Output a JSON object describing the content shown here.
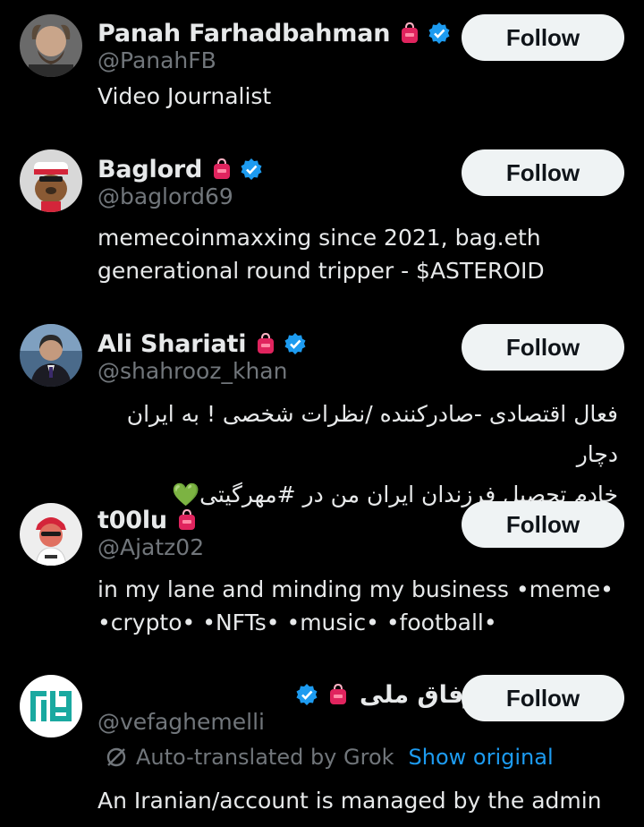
{
  "accounts": [
    {
      "name": "Panah Farhadbahman",
      "handle": "@PanahFB",
      "bio": "Video Journalist",
      "verified": true,
      "avatar_icon": "bald-man-avatar",
      "follow_label": "Follow"
    },
    {
      "name": "Baglord",
      "handle": "@baglord69",
      "bio": "memecoinmaxxing since 2021, bag.eth\ngenerational round tripper - $ASTEROID",
      "verified": true,
      "avatar_icon": "cartoon-bear-cap-avatar",
      "follow_label": "Follow"
    },
    {
      "name": "Ali Shariati",
      "handle": "@shahrooz_khan",
      "bio": "فعال اقتصادی -صادرکننده /نظرات شخصی ! به ایران دچار\nخادم تحصیل فرزندان ایران من در #مهرگیتی💚",
      "verified": true,
      "avatar_icon": "man-in-suit-avatar",
      "follow_label": "Follow"
    },
    {
      "name": "t00lu",
      "handle": "@Ajatz02",
      "bio": "in my lane and minding my business •meme•\n•crypto• •NFTs• •music• •football•",
      "verified": false,
      "avatar_icon": "cartoon-red-bandana-avatar",
      "follow_label": "Follow"
    },
    {
      "name": "وفاق ملی",
      "handle": "@vefaghemelli",
      "translation_note": "Auto-translated by Grok",
      "show_original": "Show original",
      "bio": "An Iranian/account is managed by the admin",
      "verified": true,
      "avatar_icon": "green-kufic-logo-avatar",
      "follow_label": "Follow"
    }
  ],
  "colors": {
    "background": "#000000",
    "text_primary": "#e7e9ea",
    "text_secondary": "#71767b",
    "link": "#1d9bf0",
    "verified": "#1d9bf0",
    "badge_red": "#e0245e",
    "button_bg": "#eff3f4",
    "button_text": "#0f1419"
  },
  "icons": {
    "affiliate_badge": "red-backpack-icon",
    "verified_badge": "verified-checkmark-icon",
    "translate": "slash-circle-icon"
  }
}
